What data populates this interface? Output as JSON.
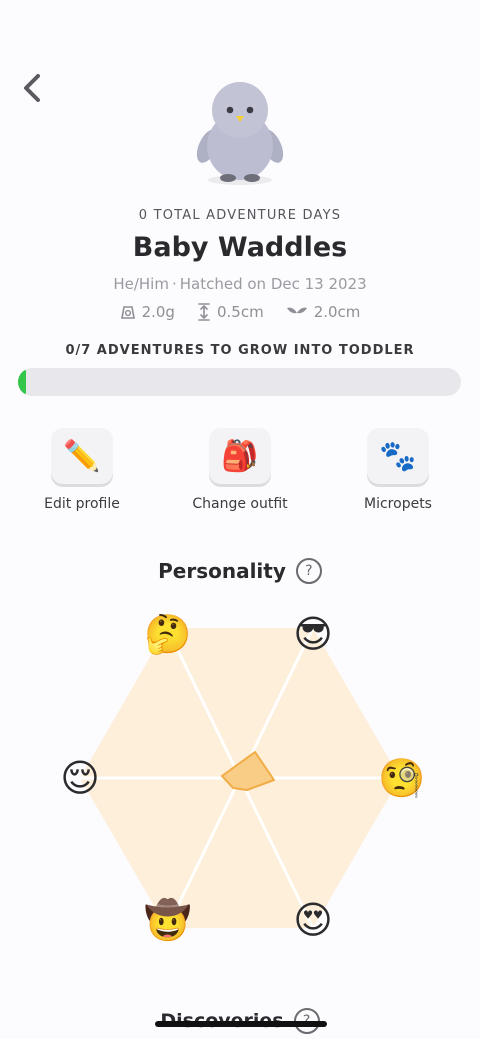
{
  "header": {
    "back_icon": "chevron-left-icon"
  },
  "pet": {
    "total_days_label": "0 TOTAL ADVENTURE DAYS",
    "name": "Baby Waddles",
    "pronouns": "He/Him",
    "hatched": "Hatched on Dec 13 2023",
    "stats": {
      "weight": "2.0g",
      "height": "0.5cm",
      "wingspan": "2.0cm"
    }
  },
  "growth": {
    "label": "0/7 ADVENTURES TO GROW INTO TODDLER",
    "progress_fraction": 0
  },
  "actions": [
    {
      "label": "Edit profile",
      "icon": "pencil-icon",
      "glyph": "✏️"
    },
    {
      "label": "Change outfit",
      "icon": "backpack-icon",
      "glyph": "🎒"
    },
    {
      "label": "Micropets",
      "icon": "paw-prints-icon",
      "glyph": "🐾"
    }
  ],
  "personality": {
    "title": "Personality",
    "help": "?",
    "traits": [
      {
        "icon": "thinking-face-icon",
        "glyph": "🤔"
      },
      {
        "icon": "sunglasses-face-icon",
        "glyph": "😎"
      },
      {
        "icon": "monocle-face-icon",
        "glyph": "🧐"
      },
      {
        "icon": "heart-eyes-face-icon",
        "glyph": "😍"
      },
      {
        "icon": "cowboy-face-icon",
        "glyph": "🤠"
      },
      {
        "icon": "relieved-face-icon",
        "glyph": "😌"
      }
    ],
    "colors": {
      "hexagon": "#fdefd9",
      "shape": "#f9cd85",
      "shape_stroke": "#f2ac45"
    }
  },
  "discoveries": {
    "title": "Discoveries",
    "help": "?"
  }
}
